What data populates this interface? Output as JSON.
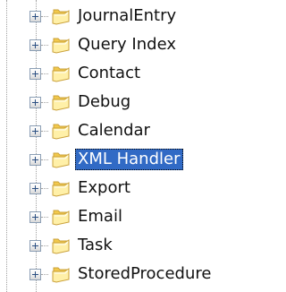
{
  "tree": {
    "items": [
      {
        "label": "JournalEntry",
        "selected": false
      },
      {
        "label": "Query Index",
        "selected": false
      },
      {
        "label": "Contact",
        "selected": false
      },
      {
        "label": "Debug",
        "selected": false
      },
      {
        "label": "Calendar",
        "selected": false
      },
      {
        "label": "XML Handler",
        "selected": true
      },
      {
        "label": "Export",
        "selected": false
      },
      {
        "label": "Email",
        "selected": false
      },
      {
        "label": "Task",
        "selected": false
      },
      {
        "label": "StoredProcedure",
        "selected": false
      }
    ]
  },
  "colors": {
    "selection": "#316ac5",
    "folder": "#f2c94c",
    "folder_dark": "#caa13a",
    "folder_light": "#fff0a8",
    "tree_line": "#a0a0a0",
    "expander_border": "#8c9fb5"
  },
  "icons": {
    "expander": "plus-square-icon",
    "folder": "folder-icon"
  }
}
